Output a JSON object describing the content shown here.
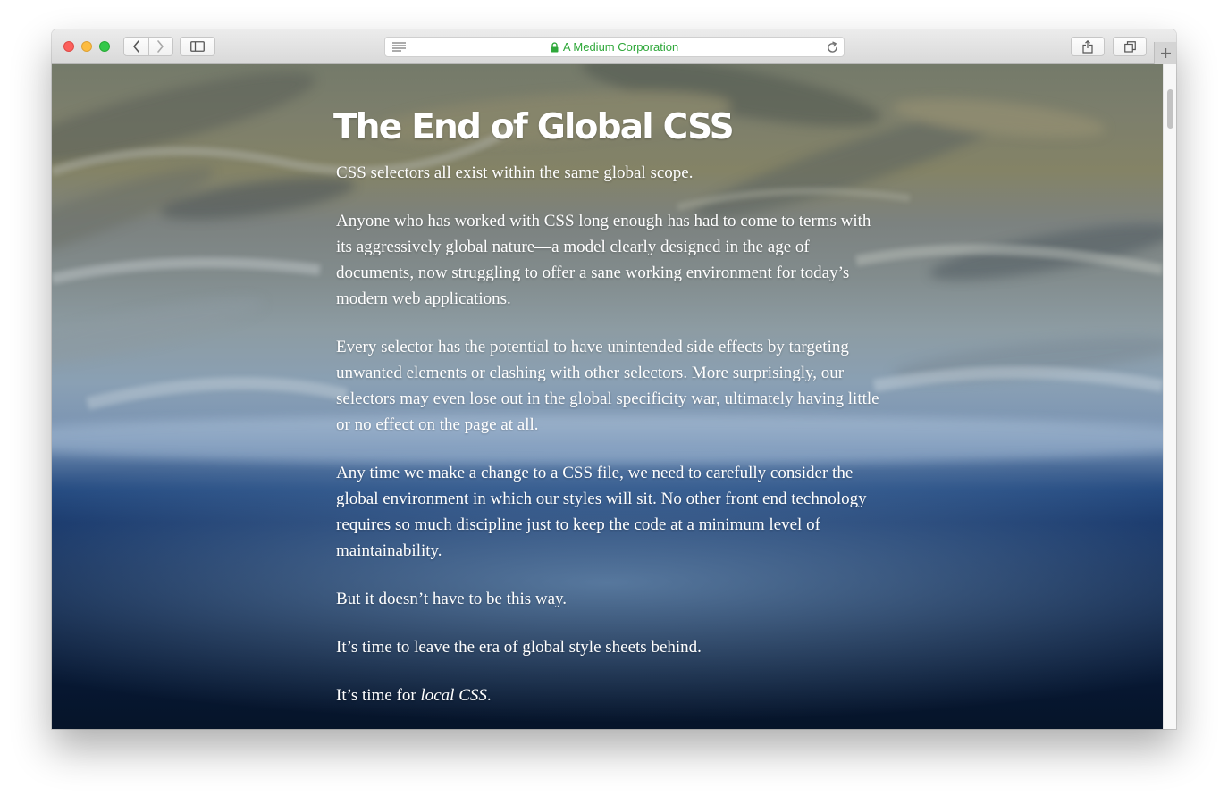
{
  "browser": {
    "address": "A Medium Corporation"
  },
  "article": {
    "title": "The End of Global CSS",
    "paragraphs": [
      "CSS selectors all exist within the same global scope.",
      "Anyone who has worked with CSS long enough has had to come to terms with its aggressively global nature—a model clearly designed in the age of documents, now struggling to offer a sane working environment for today’s modern web applications.",
      "Every selector has the potential to have unintended side effects by targeting unwanted elements or clashing with other selectors. More surprisingly, our selectors may even lose out in the global specificity war, ultimately having little or no effect on the page at all.",
      "Any time we make a change to a CSS file, we need to carefully consider the global environment in which our styles will sit. No other front end technology requires so much discipline just to keep the code at a minimum level of maintainability.",
      "But it doesn’t have to be this way.",
      "It’s time to leave the era of global style sheets behind."
    ],
    "last_paragraph": {
      "prefix": "It’s time for ",
      "emphasis": "local CSS",
      "suffix": "."
    }
  },
  "colors": {
    "address_text": "#2fa83a",
    "close": "#fc605c",
    "minimize": "#fdbc40",
    "zoom": "#34c84a"
  },
  "icons": {
    "back": "chevron-left-icon",
    "forward": "chevron-right-icon",
    "sidebar": "sidebar-icon",
    "reader": "reader-icon",
    "lock": "lock-icon",
    "reload": "reload-icon",
    "share": "share-icon",
    "tabs": "tabs-icon",
    "new_tab": "plus-icon"
  }
}
